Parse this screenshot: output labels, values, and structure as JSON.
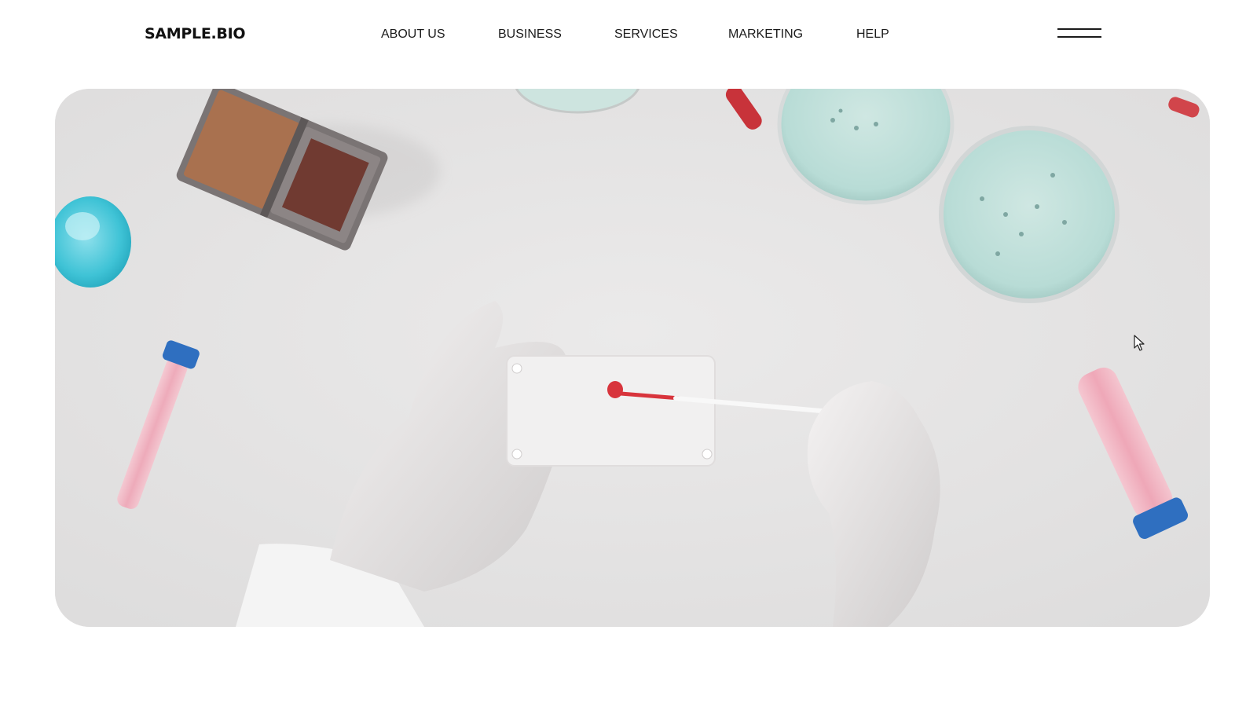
{
  "header": {
    "logo": "SAMPLE.BIO",
    "nav": [
      {
        "label": "ABOUT US"
      },
      {
        "label": "BUSINESS"
      },
      {
        "label": "SERVICES"
      },
      {
        "label": "MARKETING"
      },
      {
        "label": "HELP"
      }
    ],
    "menu_icon": "hamburger-menu-icon"
  },
  "hero": {
    "image": "laboratory-blood-sample-photo"
  },
  "colors": {
    "text": "#1b1b1b",
    "hero_background": "#e4e3e3",
    "sample_red": "#d8343c",
    "petri_teal": "#bfe0da",
    "tube_cap_blue": "#2f6fc0",
    "tube_pink": "#f2a6b6"
  }
}
